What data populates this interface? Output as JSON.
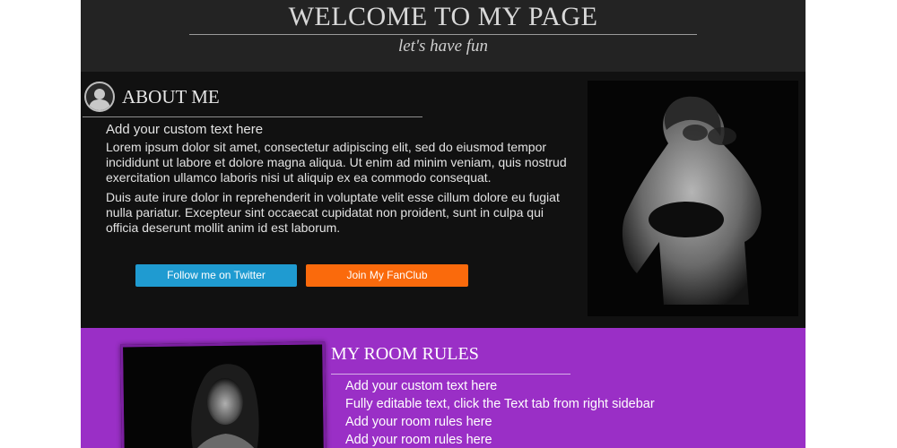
{
  "header": {
    "title": "WELCOME TO MY PAGE",
    "subtitle": "let's have fun"
  },
  "about": {
    "heading": "ABOUT ME",
    "avatar_icon": "user-silhouette-icon",
    "lead": "Add your custom text here",
    "paragraphs": [
      "Lorem ipsum dolor sit amet, consectetur adipiscing elit, sed do eiusmod tempor incididunt ut labore et dolore magna aliqua. Ut enim ad minim veniam, quis nostrud exercitation ullamco laboris nisi ut aliquip ex ea commodo consequat.",
      "Duis aute irure dolor in reprehenderit in voluptate velit esse cillum dolore eu fugiat nulla pariatur. Excepteur sint occaecat cupidatat non proident, sunt in culpa qui officia deserunt mollit anim id est laborum."
    ],
    "twitter_button": "Follow me on Twitter",
    "fanclub_button": "Join My FanClub"
  },
  "rules": {
    "heading": "MY ROOM RULES",
    "items": [
      "Add your custom text here",
      "Fully editable text, click the Text tab from right sidebar",
      "Add your room rules here",
      "Add your room rules here"
    ]
  },
  "colors": {
    "header_bg": "#232323",
    "page_bg": "#111111",
    "twitter": "#1f9bd1",
    "fanclub": "#fa6a0c",
    "rules_bg": "#9a2fc6"
  }
}
